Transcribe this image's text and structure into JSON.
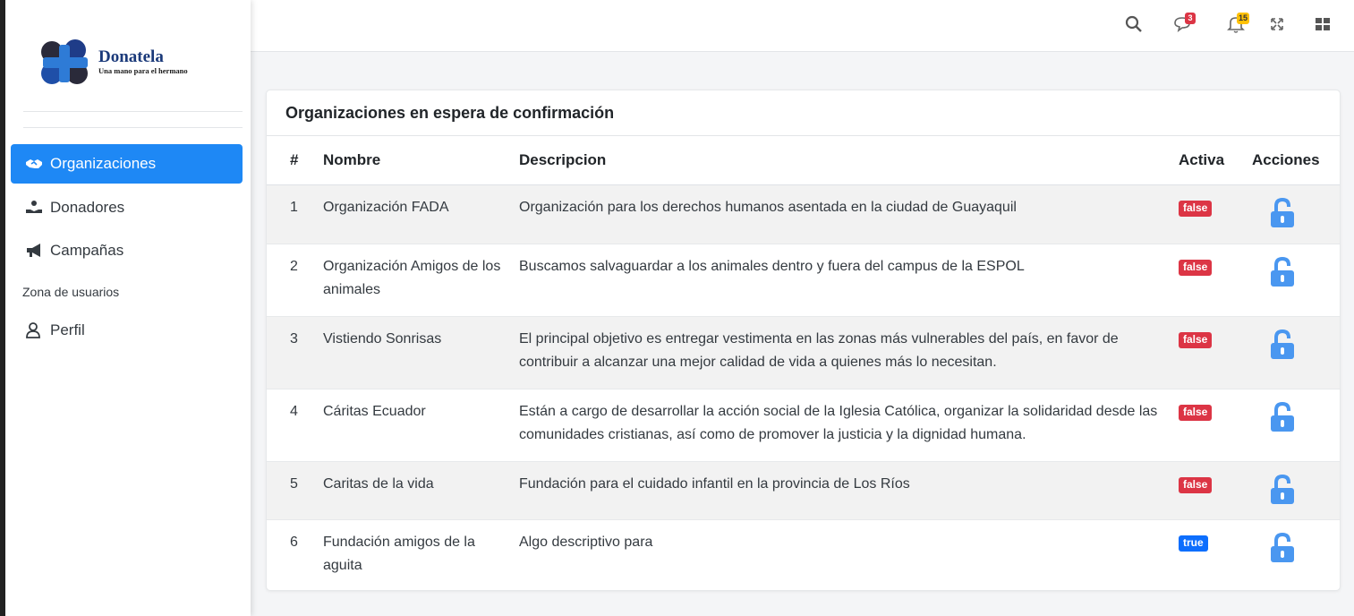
{
  "brand": {
    "name": "Donatela",
    "tagline": "Una mano para el hermano"
  },
  "sidebar": {
    "items": [
      {
        "label": "Organizaciones",
        "icon": "handshake-icon",
        "active": true
      },
      {
        "label": "Donadores",
        "icon": "hand-holding-icon",
        "active": false
      },
      {
        "label": "Campañas",
        "icon": "megaphone-icon",
        "active": false
      }
    ],
    "section_label": "Zona de usuarios",
    "profile": {
      "label": "Perfil",
      "icon": "user-icon"
    }
  },
  "topbar": {
    "messages_count": "3",
    "notifications_count": "15"
  },
  "card": {
    "title": "Organizaciones en espera de confirmación"
  },
  "table": {
    "headers": {
      "num": "#",
      "name": "Nombre",
      "description": "Descripcion",
      "active": "Activa",
      "actions": "Acciones"
    },
    "rows": [
      {
        "num": "1",
        "name": "Organización FADA",
        "description": "Organización para los derechos humanos asentada en la ciudad de Guayaquil",
        "active": "false"
      },
      {
        "num": "2",
        "name": "Organización Amigos de los animales",
        "description": "Buscamos salvaguardar a los animales dentro y fuera del campus de la ESPOL",
        "active": "false"
      },
      {
        "num": "3",
        "name": "Vistiendo Sonrisas",
        "description": "El principal objetivo es entregar vestimenta en las zonas más vulnerables del país, en favor de contribuir a alcanzar una mejor calidad de vida a quienes más lo necesitan.",
        "active": "false"
      },
      {
        "num": "4",
        "name": "Cáritas Ecuador",
        "description": "Están a cargo de desarrollar la acción social de la Iglesia Católica, organizar la solidaridad desde las comunidades cristianas, así como de promover la justicia y la dignidad humana.",
        "active": "false"
      },
      {
        "num": "5",
        "name": "Caritas de la vida",
        "description": "Fundación para el cuidado infantil en la provincia de Los Ríos",
        "active": "false"
      },
      {
        "num": "6",
        "name": "Fundación amigos de la aguita",
        "description": "Algo descriptivo para",
        "active": "true"
      }
    ]
  },
  "colors": {
    "primary": "#1e88f5",
    "danger": "#dc3545",
    "info": "#0d6efd",
    "lock": "#4a97f0",
    "brand_navy": "#1b3a7a"
  }
}
